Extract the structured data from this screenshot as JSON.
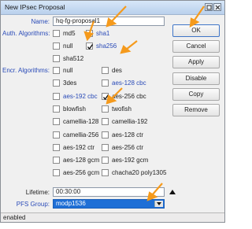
{
  "window": {
    "title": "New IPsec Proposal",
    "status": "enabled"
  },
  "form": {
    "name_label": "Name:",
    "name_value": "hq-fg-proposal1",
    "auth_label": "Auth. Algorithms:",
    "auth": [
      {
        "label": "md5",
        "checked": false,
        "blue": false
      },
      {
        "label": "sha1",
        "checked": false,
        "blue": true
      },
      {
        "label": "null",
        "checked": false,
        "blue": false
      },
      {
        "label": "sha256",
        "checked": true,
        "blue": true
      },
      {
        "label": "sha512",
        "checked": false,
        "blue": false
      }
    ],
    "encr_label": "Encr. Algorithms:",
    "encr": [
      {
        "label": "null",
        "checked": false,
        "blue": false
      },
      {
        "label": "des",
        "checked": false,
        "blue": false
      },
      {
        "label": "3des",
        "checked": false,
        "blue": false
      },
      {
        "label": "aes-128 cbc",
        "checked": false,
        "blue": true
      },
      {
        "label": "aes-192 cbc",
        "checked": false,
        "blue": true
      },
      {
        "label": "aes-256 cbc",
        "checked": true,
        "blue": false
      },
      {
        "label": "blowfish",
        "checked": false,
        "blue": false
      },
      {
        "label": "twofish",
        "checked": false,
        "blue": false
      },
      {
        "label": "camellia-128",
        "checked": false,
        "blue": false
      },
      {
        "label": "camellia-192",
        "checked": false,
        "blue": false
      },
      {
        "label": "camellia-256",
        "checked": false,
        "blue": false
      },
      {
        "label": "aes-128 ctr",
        "checked": false,
        "blue": false
      },
      {
        "label": "aes-192 ctr",
        "checked": false,
        "blue": false
      },
      {
        "label": "aes-256 ctr",
        "checked": false,
        "blue": false
      },
      {
        "label": "aes-128 gcm",
        "checked": false,
        "blue": false
      },
      {
        "label": "aes-192 gcm",
        "checked": false,
        "blue": false
      },
      {
        "label": "aes-256 gcm",
        "checked": false,
        "blue": false
      },
      {
        "label": "chacha20 poly1305",
        "checked": false,
        "blue": false
      }
    ],
    "lifetime_label": "Lifetime:",
    "lifetime_value": "00:30:00",
    "pfs_label": "PFS Group:",
    "pfs_value": "modp1536"
  },
  "buttons": {
    "ok": "OK",
    "cancel": "Cancel",
    "apply": "Apply",
    "disable": "Disable",
    "copy": "Copy",
    "remove": "Remove"
  },
  "colors": {
    "label_blue": "#2a4bb8",
    "selection": "#1f6fd6",
    "annotation_arrow": "#f59a1c"
  }
}
